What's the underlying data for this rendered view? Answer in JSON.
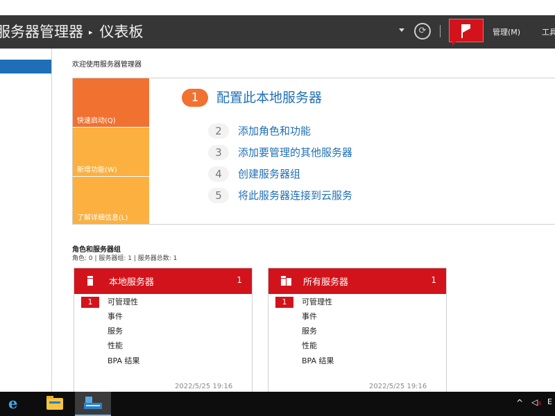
{
  "header": {
    "breadcrumb_app": "服务器管理器",
    "breadcrumb_sep": "▸",
    "breadcrumb_page": "仪表板",
    "refresh_glyph": "⟳",
    "menu_manage": "管理(M)",
    "menu_tools": "工具"
  },
  "welcome": {
    "title": "欢迎使用服务器管理器"
  },
  "quickstart": {
    "tiles": [
      "快速启动(Q)",
      "新增功能(W)",
      "了解详细信息(L)"
    ],
    "steps": [
      {
        "num": "1",
        "label": "配置此本地服务器"
      },
      {
        "num": "2",
        "label": "添加角色和功能"
      },
      {
        "num": "3",
        "label": "添加要管理的其他服务器"
      },
      {
        "num": "4",
        "label": "创建服务器组"
      },
      {
        "num": "5",
        "label": "将此服务器连接到云服务"
      }
    ]
  },
  "roles": {
    "title": "角色和服务器组",
    "summary": "角色: 0 | 服务器组: 1 | 服务器总数: 1",
    "cards": [
      {
        "title": "本地服务器",
        "count": "1",
        "alert_count": "1",
        "rows": [
          "可管理性",
          "事件",
          "服务",
          "性能",
          "BPA 结果"
        ],
        "timestamp": "2022/5/25 19:16"
      },
      {
        "title": "所有服务器",
        "count": "1",
        "alert_count": "1",
        "rows": [
          "可管理性",
          "事件",
          "服务",
          "性能",
          "BPA 结果"
        ],
        "timestamp": "2022/5/25 19:16"
      }
    ]
  },
  "taskbar": {
    "ie_glyph": "e",
    "tray_caret": "^",
    "volume_glyph": "◁",
    "volume_mute": "x",
    "ime_label": "E"
  },
  "colors": {
    "titlebar": "#363636",
    "accent_red": "#d3131b",
    "quickstart_orange": "#f17131",
    "quickstart_amber": "#fbb040",
    "link_blue": "#1f6fb6"
  }
}
